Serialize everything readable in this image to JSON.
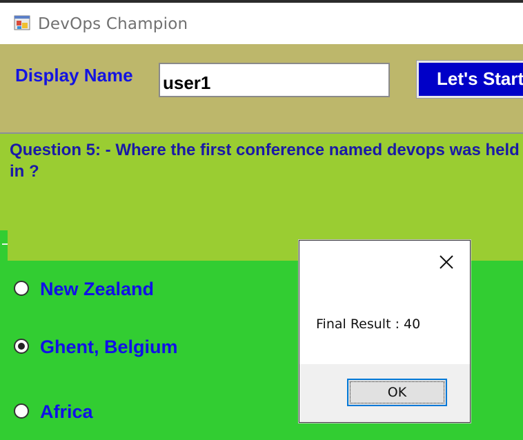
{
  "window": {
    "title": "DevOps Champion",
    "icon": "app-window-icon"
  },
  "header": {
    "display_name_label": "Display Name",
    "display_name_value": "user1",
    "start_button_label": "Let's Start"
  },
  "question": {
    "text": "Question 5: - Where the first conference named devops was held in ?"
  },
  "options": [
    {
      "label": "New Zealand",
      "checked": false
    },
    {
      "label": "Ghent, Belgium",
      "checked": true
    },
    {
      "label": "Africa",
      "checked": false
    }
  ],
  "dialog": {
    "message": "Final Result : 40",
    "ok_label": "OK",
    "close_icon": "close-icon"
  },
  "colors": {
    "header_bg": "#bdb76b",
    "question_bg": "#9acd32",
    "options_bg": "#32cd32",
    "label_blue": "#1414e0",
    "button_blue": "#0000c8"
  }
}
